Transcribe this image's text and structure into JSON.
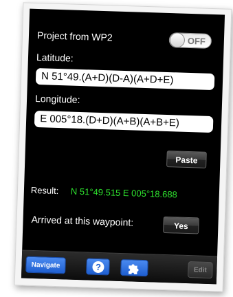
{
  "project": {
    "label": "Project from WP2",
    "toggle_text": "OFF"
  },
  "latitude": {
    "label": "Latitude:",
    "value": "N 51°49.(A+D)(D-A)(A+D+E)"
  },
  "longitude": {
    "label": "Longitude:",
    "value": "E 005°18.(D+D)(A+B)(A+B+E)"
  },
  "paste_button": "Paste",
  "result": {
    "label": "Result:",
    "value": "N 51°49.515 E 005°18.688"
  },
  "arrived": {
    "label": "Arrived at this waypoint:",
    "button": "Yes"
  },
  "toolbar": {
    "navigate": "Navigate",
    "help_glyph": "?",
    "edit": "Edit"
  },
  "icons": {
    "help": "question-mark-icon",
    "puzzle": "puzzle-piece-icon"
  },
  "colors": {
    "result_value": "#2ee02e",
    "toolbar_blue": "#1f5fd0"
  }
}
